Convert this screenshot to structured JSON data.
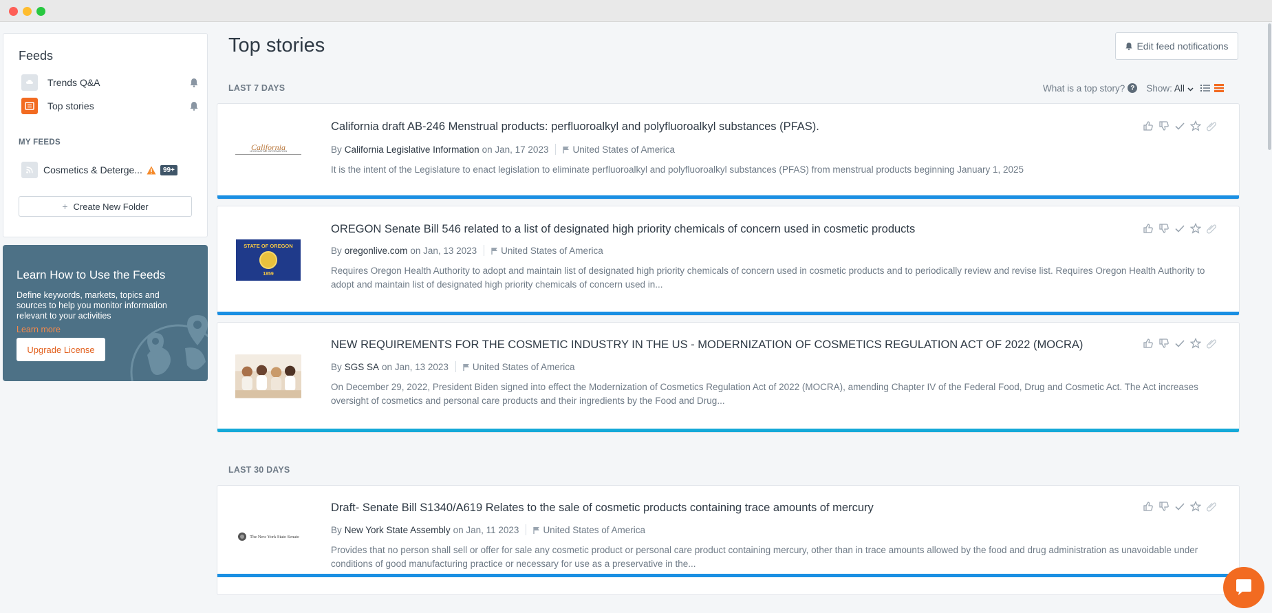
{
  "sidebar": {
    "title": "Feeds",
    "items": [
      {
        "label": "Trends Q&A",
        "icon": "trends-qa-icon"
      },
      {
        "label": "Top stories",
        "icon": "top-stories-icon"
      }
    ],
    "my_feeds_label": "MY FEEDS",
    "my_feeds": [
      {
        "label": "Cosmetics & Deterge...",
        "icon": "rss-icon",
        "badge": "99+"
      }
    ],
    "create_folder_label": "Create New Folder"
  },
  "promo": {
    "title": "Learn How to Use the Feeds",
    "text": "Define keywords, markets, topics and sources to help you monitor information relevant to your activities",
    "link": "Learn more",
    "button": "Upgrade License"
  },
  "main": {
    "title": "Top stories",
    "edit_button": "Edit feed notifications",
    "help_text": "What is a top story?",
    "help_glyph": "?",
    "show_label": "Show:",
    "show_value": "All",
    "sections": [
      {
        "label": "LAST 7 DAYS",
        "stories": [
          {
            "title": "California draft AB-246 Menstrual products: perfluoroalkyl and polyfluoroalkyl substances (PFAS).",
            "by": "By",
            "source": "California Legislative Information",
            "date": "on Jan, 17 2023",
            "country": "United States of America",
            "snippet": "It is the intent of the Legislature to enact legislation to eliminate perfluoroalkyl and polyfluoroalkyl substances (PFAS) from menstrual products beginning January 1, 2025",
            "logo_text": "California",
            "logo_sub": "LEGISLATIVE INFORMATION"
          },
          {
            "title": "OREGON Senate Bill 546 related to a list of designated high priority chemicals of concern used in cosmetic products",
            "by": "By",
            "source": "oregonlive.com",
            "date": "on Jan, 13 2023",
            "country": "United States of America",
            "snippet": "Requires Oregon Health Authority to adopt and maintain list of designated high priority chemicals of concern used in cosmetic products and to periodically review and revise list. Requires Oregon Health Authority to adopt and maintain list of designated high priority chemicals of concern used in...",
            "logo_text": "STATE OF OREGON",
            "logo_sub": "1859"
          },
          {
            "title": "NEW REQUIREMENTS FOR THE COSMETIC INDUSTRY IN THE US - MODERNIZATION OF COSMETICS REGULATION ACT OF 2022 (MOCRA)",
            "by": "By",
            "source": "SGS SA",
            "date": "on Jan, 13 2023",
            "country": "United States of America",
            "snippet": "On December 29, 2022, President Biden signed into effect the Modernization of Cosmetics Regulation Act of 2022 (MOCRA), amending Chapter IV of the Federal Food, Drug and Cosmetic Act. The Act increases oversight of cosmetics and personal care products and their ingredients by the Food and Drug..."
          }
        ]
      },
      {
        "label": "LAST 30 DAYS",
        "stories": [
          {
            "title": "Draft- Senate Bill S1340/A619 Relates to the sale of cosmetic products containing trace amounts of mercury",
            "by": "By",
            "source": "New York State Assembly",
            "date": "on Jan, 11 2023",
            "country": "United States of America",
            "snippet": "Provides that no person shall sell or offer for sale any cosmetic product or personal care product containing mercury, other than in trace amounts allowed by the food and drug administration as unavoidable under conditions of good manufacturing practice or necessary for use as a preservative in the...",
            "logo_text": "The New York State Senate"
          }
        ]
      }
    ]
  },
  "colors": {
    "accent": "#f26b21",
    "story_bar": "#1a8fe3",
    "promo_bg": "#4d7186"
  }
}
